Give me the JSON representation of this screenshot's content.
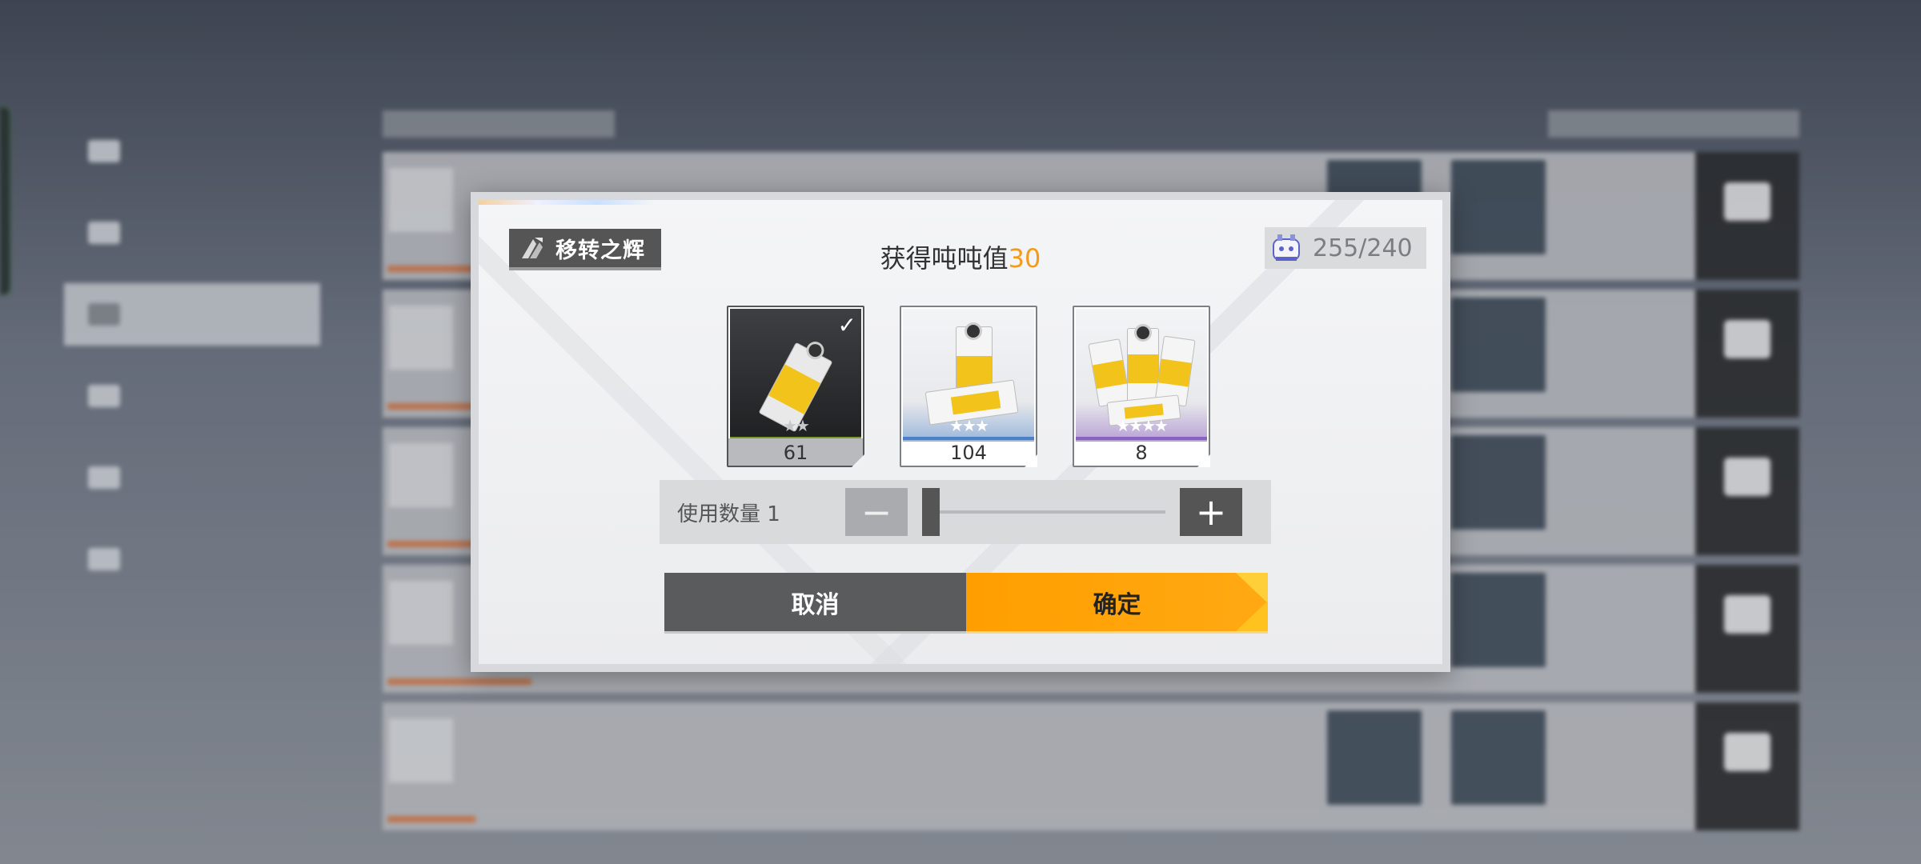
{
  "dialog": {
    "title": "移转之辉",
    "heading_prefix": "获得吨吨值",
    "heading_value": "30",
    "counter": "255/240",
    "items": [
      {
        "rarity": "★★",
        "count": "61",
        "selected": true
      },
      {
        "rarity": "★★★",
        "count": "104",
        "selected": false
      },
      {
        "rarity": "★★★★",
        "count": "8",
        "selected": false
      }
    ],
    "quantity": {
      "label": "使用数量 1",
      "minus": "−",
      "plus": "+",
      "value": 1,
      "max": 61
    },
    "cancel_label": "取消",
    "confirm_label": "确定"
  },
  "icons": {
    "badge": "transfer-glow-icon",
    "counter": "tonton-robot-icon",
    "check": "check-icon"
  },
  "colors": {
    "accent_orange": "#f59a18",
    "confirm_button": "#ff9e00",
    "dark_button": "#5a5b5d"
  }
}
